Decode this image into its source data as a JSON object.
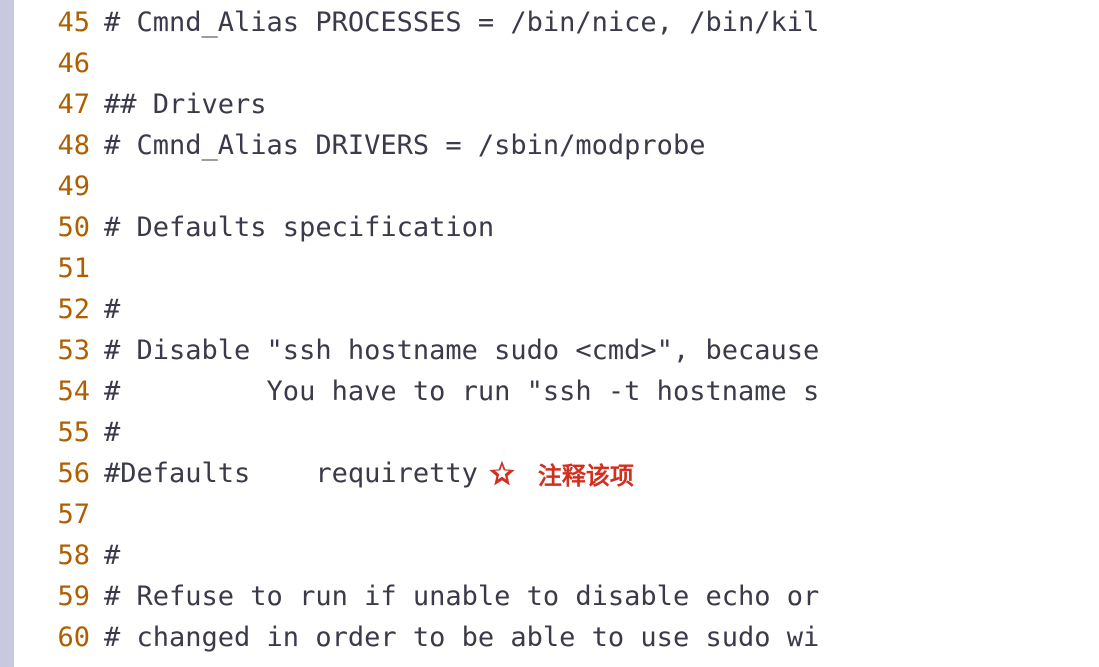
{
  "lines": [
    {
      "num": "45",
      "text": "# Cmnd_Alias PROCESSES = /bin/nice, /bin/kil"
    },
    {
      "num": "46",
      "text": ""
    },
    {
      "num": "47",
      "text": "## Drivers"
    },
    {
      "num": "48",
      "text": "# Cmnd_Alias DRIVERS = /sbin/modprobe"
    },
    {
      "num": "49",
      "text": ""
    },
    {
      "num": "50",
      "text": "# Defaults specification"
    },
    {
      "num": "51",
      "text": ""
    },
    {
      "num": "52",
      "text": "#"
    },
    {
      "num": "53",
      "text": "# Disable \"ssh hostname sudo <cmd>\", because"
    },
    {
      "num": "54",
      "text": "#         You have to run \"ssh -t hostname s"
    },
    {
      "num": "55",
      "text": "#"
    },
    {
      "num": "56",
      "text": "#Defaults    requiretty",
      "star": true,
      "note": "注释该项"
    },
    {
      "num": "57",
      "text": ""
    },
    {
      "num": "58",
      "text": "#"
    },
    {
      "num": "59",
      "text": "# Refuse to run if unable to disable echo or"
    },
    {
      "num": "60",
      "text": "# changed in order to be able to use sudo wi"
    }
  ],
  "colors": {
    "line_number": "#af5f00",
    "text": "#3a3a4a",
    "annotation": "#d03020",
    "left_bar": "#c8c8df"
  }
}
